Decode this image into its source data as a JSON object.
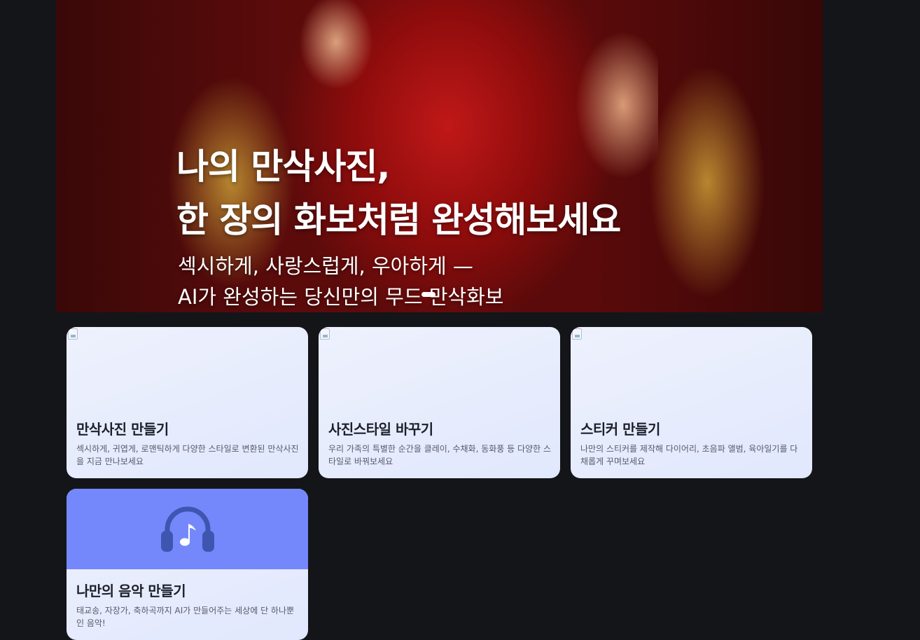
{
  "hero": {
    "title_line1": "나의 만삭사진,",
    "title_line2": "한 장의 화보처럼 완성해보세요",
    "subtitle_line1": "섹시하게, 사랑스럽게, 우아하게 —",
    "subtitle_line2": "AI가 완성하는 당신만의 무드 만삭화보"
  },
  "cards": [
    {
      "title": "만삭사진 만들기",
      "description": "섹시하게, 귀엽게, 로맨틱하게 다양한 스타일로 변환된 만삭사진을 지금 만나보세요"
    },
    {
      "title": "사진스타일 바꾸기",
      "description": "우리 가족의 특별한 순간을 클레이, 수채화, 동화풍 등 다양한 스타일로 바꿔보세요"
    },
    {
      "title": "스티커 만들기",
      "description": "나만의 스티커를 제작해 다이어리, 초음파 앨범, 육아일기를 다채롭게 꾸며보세요"
    },
    {
      "title": "나만의 음악 만들기",
      "description": "태교송, 자장가, 축하곡까지 AI가 만들어주는 세상에 단 하나뿐인 음악!",
      "icon": "headphones-music-icon"
    }
  ],
  "colors": {
    "page_background": "#141519",
    "card_background": "#e6ebfd",
    "music_accent": "#7488fc",
    "icon_dark": "#3e56b0"
  }
}
